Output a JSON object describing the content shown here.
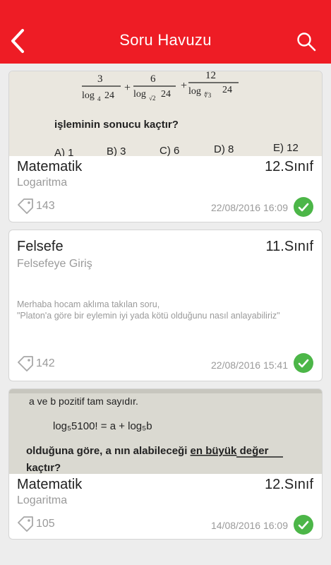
{
  "header": {
    "title": "Soru Havuzu",
    "back_icon": "chevron-left-icon",
    "search_icon": "search-icon",
    "accent": "#ee1c25"
  },
  "cards": [
    {
      "subject": "Matematik",
      "grade": "12.Sınıf",
      "topic": "Logaritma",
      "count": "143",
      "date": "22/08/2016 16:09",
      "image_text": {
        "line1": "işleminin sonucu kaçtır?",
        "choices": [
          "A) 1",
          "B) 3",
          "C) 6",
          "D) 8",
          "E) 12"
        ]
      }
    },
    {
      "subject": "Felsefe",
      "grade": "11.Sınıf",
      "topic": "Felsefeye Giriş",
      "description_line1": "Merhaba hocam aklıma takılan soru,",
      "description_line2": "\"Platon'a göre bir eylemin iyi yada kötü olduğunu nasıl anlayabiliriz\"",
      "count": "142",
      "date": "22/08/2016 15:41"
    },
    {
      "subject": "Matematik",
      "grade": "12.Sınıf",
      "topic": "Logaritma",
      "count": "105",
      "date": "14/08/2016 16:09",
      "image_text": {
        "line1": "a ve b pozitif tam sayıdır.",
        "line2": "log₅5100! = a + log₅b",
        "line3a": "olduğuna göre, a nın alabileceği ",
        "line3b": "en büyük",
        "line3c": " değer",
        "line4": "kaçtır?"
      }
    }
  ],
  "status_color": "#4cb648"
}
